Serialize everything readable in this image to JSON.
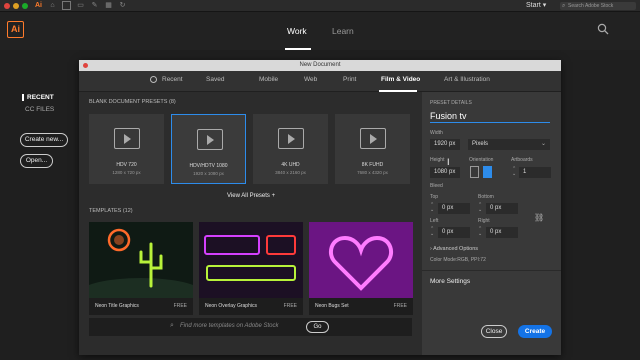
{
  "menubar": {
    "start_label": "Start",
    "search_placeholder": "Search Adobe Stock",
    "app_logo_text": "Ai"
  },
  "header": {
    "logo_text": "Ai",
    "nav": [
      "Work",
      "Learn"
    ]
  },
  "sidebar": {
    "recent": "RECENT",
    "cc_files": "CC FILES",
    "create_new": "Create new...",
    "open": "Open..."
  },
  "dialog": {
    "title": "New Document",
    "tabs": [
      "Recent",
      "Saved",
      "Mobile",
      "Web",
      "Print",
      "Film & Video",
      "Art & Illustration"
    ],
    "active_tab": "Film & Video",
    "blank_presets_label": "BLANK DOCUMENT PRESETS",
    "blank_presets_count": "(8)",
    "presets": [
      {
        "name": "HDV 720",
        "size": "1280 x 720 px"
      },
      {
        "name": "HDV/HDTV 1080",
        "size": "1920 x 1080 px"
      },
      {
        "name": "4K UHD",
        "size": "3840 x 2160 px"
      },
      {
        "name": "8K FUHD",
        "size": "7680 x 4320 px"
      }
    ],
    "view_all": "View All Presets",
    "view_all_icon": "+",
    "templates_label": "TEMPLATES",
    "templates_count": "(12)",
    "templates": [
      {
        "name": "Neon Title Graphics",
        "badge": "FREE"
      },
      {
        "name": "Neon Overlay Graphics",
        "badge": "FREE"
      },
      {
        "name": "Neon Bugs Set",
        "badge": "FREE"
      }
    ],
    "stock_placeholder": "Find more templates on Adobe Stock",
    "go_label": "Go",
    "preset_details": {
      "heading": "PRESET DETAILS",
      "name": "Fusion tv",
      "width_label": "Width",
      "width_value": "1920 px",
      "units": "Pixels",
      "height_label": "Height",
      "height_value": "1080 px",
      "orientation_label": "Orientation",
      "artboards_label": "Artboards",
      "artboards_value": "1",
      "bleed_label": "Bleed",
      "top_label": "Top",
      "top_value": "0 px",
      "bottom_label": "Bottom",
      "bottom_value": "0 px",
      "left_label": "Left",
      "left_value": "0 px",
      "right_label": "Right",
      "right_value": "0 px",
      "advanced_options": "Advanced Options",
      "color_mode": "Color Mode:RGB, PPI:72",
      "more_settings": "More Settings",
      "close_label": "Close",
      "create_label": "Create"
    }
  },
  "colors": {
    "accent": "#1473e6",
    "ai_orange": "#ff7b2b",
    "selection_blue": "#2d8ceb"
  }
}
